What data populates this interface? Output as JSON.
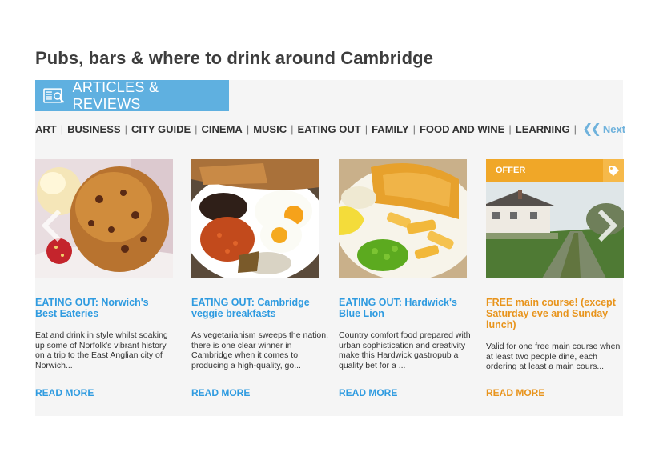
{
  "page": {
    "title": "Pubs, bars & where to drink around Cambridge"
  },
  "section": {
    "label": "ARTICLES & REVIEWS",
    "icon": "newspaper-search-icon"
  },
  "categories": [
    "ART",
    "BUSINESS",
    "CITY GUIDE",
    "CINEMA",
    "MUSIC",
    "EATING OUT",
    "FAMILY",
    "FOOD AND WINE",
    "LEARNING"
  ],
  "nav": {
    "next_label": "Next",
    "next_icon": "double-chevron-left-icon"
  },
  "cards": [
    {
      "headline": "EATING OUT: Norwich's Best Eateries",
      "description": "Eat and drink in style whilst soaking up some of Norfolk's vibrant history on a trip to the East Anglian city of Norwich...",
      "read_more": "READ MORE",
      "image": "scone-with-cream-and-strawberry"
    },
    {
      "headline": "EATING OUT: Cambridge veggie breakfasts",
      "description": "As vegetarianism sweeps the nation, there is one clear winner in Cambridge when it comes to producing a high-quality, go...",
      "read_more": "READ MORE",
      "image": "vegetarian-breakfast-plate"
    },
    {
      "headline": "EATING OUT: Hardwick's Blue Lion",
      "description": "Country comfort food prepared with urban sophistication and creativity make this Hardwick gastropub a quality bet for a ...",
      "read_more": "READ MORE",
      "image": "fish-and-chips-with-peas"
    },
    {
      "badge": "OFFER",
      "badge_icon": "price-tag-icon",
      "headline": "FREE main course! (except Saturday eve and Sunday lunch)",
      "description": "Valid for one free main course when at least two people dine, each ordering at least a main cours...",
      "read_more": "READ MORE",
      "image": "country-lane-with-cottages"
    }
  ],
  "colors": {
    "accent_blue": "#2f9be0",
    "tab_blue": "#5fb0e0",
    "offer_orange": "#e8941c",
    "panel_bg": "#f5f5f5"
  }
}
